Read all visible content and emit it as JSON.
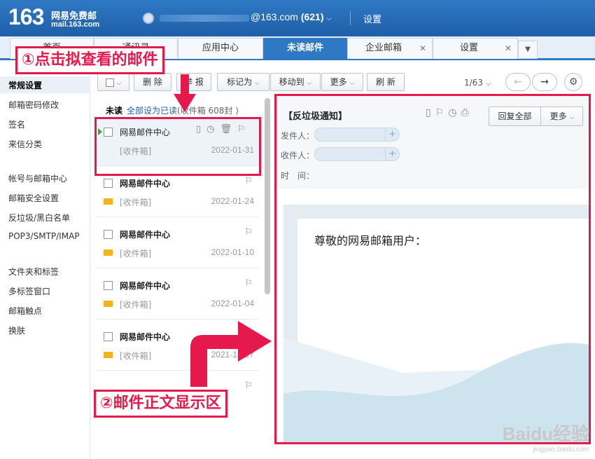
{
  "header": {
    "logo_number": "163",
    "logo_cn": "网易免费邮",
    "logo_en": "mail.163.com",
    "account_domain": "@163.com",
    "unread_count": "(621)",
    "settings_label": "设置"
  },
  "tabs": [
    {
      "label": "首页"
    },
    {
      "label": "通讯录"
    },
    {
      "label": "应用中心"
    },
    {
      "label": "未读邮件"
    },
    {
      "label": "企业邮箱"
    },
    {
      "label": "设置"
    }
  ],
  "sidebar": {
    "items": [
      {
        "label": "常规设置"
      },
      {
        "label": "邮箱密码修改"
      },
      {
        "label": "签名"
      },
      {
        "label": "来信分类"
      },
      {
        "label": "帐号与邮箱中心"
      },
      {
        "label": "邮箱安全设置"
      },
      {
        "label": "反垃圾/黑白名单"
      },
      {
        "label": "POP3/SMTP/IMAP"
      },
      {
        "label": "文件夹和标签"
      },
      {
        "label": "多标签窗口"
      },
      {
        "label": "邮箱触点"
      },
      {
        "label": "换肤"
      }
    ]
  },
  "toolbar": {
    "delete": "删 除",
    "report": "举 报",
    "mark_as": "标记为",
    "move_to": "移动到",
    "more": "更多",
    "refresh": "刷 新",
    "pager": "1/63"
  },
  "list": {
    "unread_label": "未读",
    "mark_all_read": "全部设为已读",
    "inbox_count": "(收件箱 608封 )",
    "rows": [
      {
        "sender": "网易邮件中心",
        "folder": "[收件箱]",
        "date": "2022-01-31"
      },
      {
        "sender": "网易邮件中心",
        "folder": "[收件箱]",
        "date": "2022-01-24"
      },
      {
        "sender": "网易邮件中心",
        "folder": "[收件箱]",
        "date": "2022-01-10"
      },
      {
        "sender": "网易邮件中心",
        "folder": "[收件箱]",
        "date": "2022-01-04"
      },
      {
        "sender": "网易邮件中心",
        "folder": "[收件箱]",
        "date": "2021-12-27"
      }
    ]
  },
  "reader": {
    "title": "【反垃圾通知】",
    "from_label": "发件人：",
    "to_label": "收件人：",
    "time_label": "时　间：",
    "reply_all": "回复全部",
    "more": "更多",
    "greeting": "尊敬的网易邮箱用户："
  },
  "annotations": {
    "step1": "①点击拟查看的邮件",
    "step2": "②邮件正文显示区"
  },
  "watermark": {
    "brand": "Baidu经验",
    "url": "jingyan.baidu.com"
  },
  "colors": {
    "brand_blue": "#2f79c4",
    "annotation_red": "#e6194c",
    "unread_envelope": "#f0b51e"
  }
}
